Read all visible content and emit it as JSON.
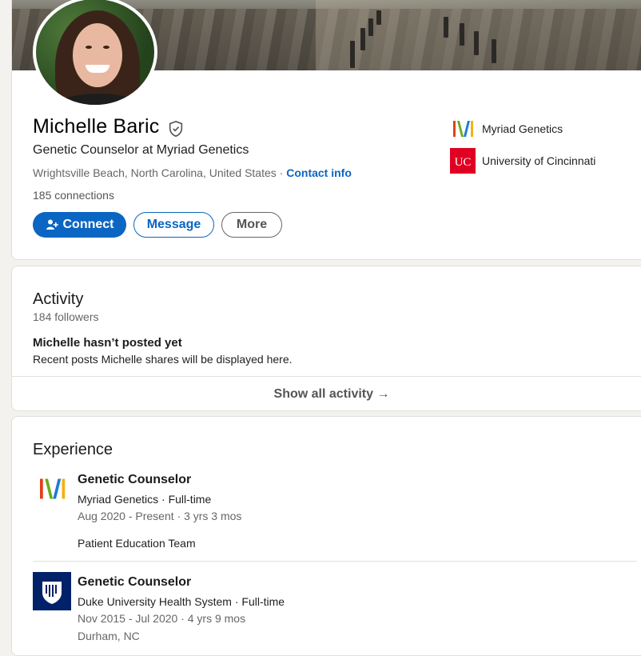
{
  "profile": {
    "name": "Michelle Baric",
    "headline": "Genetic Counselor at Myriad Genetics",
    "location": "Wrightsville Beach, North Carolina, United States",
    "location_separator": " · ",
    "contact_info": "Contact info",
    "connections": "185 connections",
    "buttons": {
      "connect": "Connect",
      "message": "Message",
      "more": "More"
    },
    "orgs": [
      {
        "name": "Myriad Genetics",
        "icon": "myriad-genetics-logo"
      },
      {
        "name": "University of Cincinnati",
        "icon": "university-of-cincinnati-logo"
      }
    ],
    "accent_color": "#0a66c2"
  },
  "activity": {
    "title": "Activity",
    "followers": "184 followers",
    "empty_title": "Michelle hasn’t posted yet",
    "empty_text": "Recent posts Michelle shares will be displayed here.",
    "show_all": "Show all activity →"
  },
  "experience": {
    "title": "Experience",
    "items": [
      {
        "title": "Genetic Counselor",
        "company": "Myriad Genetics · Full-time",
        "dates": "Aug 2020 - Present · 3 yrs 3 mos",
        "description": "Patient Education Team",
        "icon": "myriad-genetics-logo"
      },
      {
        "title": "Genetic Counselor",
        "company": "Duke University Health System · Full-time",
        "dates": "Nov 2015 - Jul 2020 · 4 yrs 9 mos",
        "location": "Durham, NC",
        "icon": "duke-health-logo"
      }
    ]
  }
}
